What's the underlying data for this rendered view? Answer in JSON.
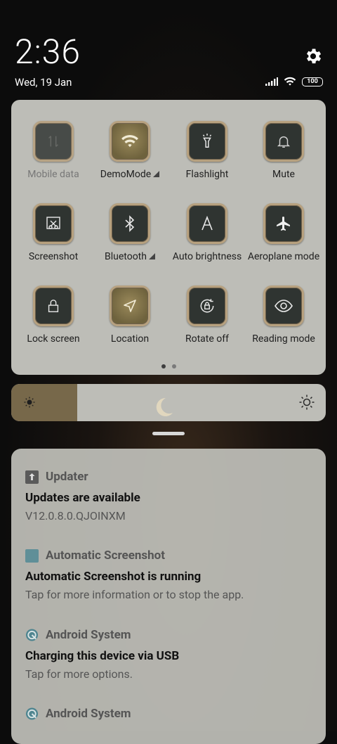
{
  "status": {
    "time": "2:36",
    "date": "Wed, 19 Jan",
    "battery": "100",
    "icons": [
      "signal-icon",
      "wifi-icon",
      "battery-icon"
    ]
  },
  "quick_settings": {
    "tiles": [
      {
        "label": "Mobile data",
        "icon": "mobile-data-icon",
        "state": "disabled"
      },
      {
        "label": "DemoMode",
        "icon": "wifi-icon",
        "state": "on",
        "expand": true
      },
      {
        "label": "Flashlight",
        "icon": "flashlight-icon",
        "state": "off"
      },
      {
        "label": "Mute",
        "icon": "bell-icon",
        "state": "off"
      },
      {
        "label": "Screenshot",
        "icon": "screenshot-icon",
        "state": "off"
      },
      {
        "label": "Bluetooth",
        "icon": "bluetooth-icon",
        "state": "off",
        "expand": true
      },
      {
        "label": "Auto brightness",
        "icon": "auto-brightness-icon",
        "state": "off"
      },
      {
        "label": "Aeroplane mode",
        "icon": "airplane-icon",
        "state": "off"
      },
      {
        "label": "Lock screen",
        "icon": "lock-icon",
        "state": "off"
      },
      {
        "label": "Location",
        "icon": "location-icon",
        "state": "on"
      },
      {
        "label": "Rotate off",
        "icon": "rotate-lock-icon",
        "state": "off"
      },
      {
        "label": "Reading mode",
        "icon": "eye-icon",
        "state": "off"
      }
    ],
    "pages": 2,
    "current_page": 1
  },
  "brightness": {
    "level": 0.21
  },
  "notifications": [
    {
      "app": "Updater",
      "icon": "updater-icon",
      "title": "Updates are available",
      "text": "V12.0.8.0.QJOINXM"
    },
    {
      "app": "Automatic Screenshot",
      "icon": "app-square-icon",
      "title": "Automatic Screenshot is running",
      "text": "Tap for more information or to stop the app."
    },
    {
      "app": "Android System",
      "icon": "android-system-icon",
      "title": "Charging this device via USB",
      "text": "Tap for more options."
    },
    {
      "app": "Android System",
      "icon": "android-system-icon",
      "title": "",
      "text": ""
    }
  ],
  "colors": {
    "tile_on": "#8a7b52",
    "tile_off": "#2f3431",
    "panel": "#bdbdb7",
    "tile_border": "#b7a17f"
  }
}
